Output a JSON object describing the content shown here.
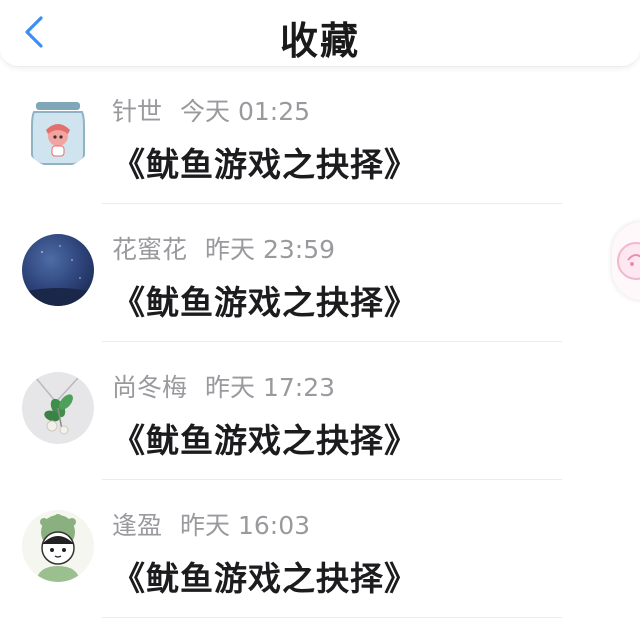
{
  "header": {
    "title": "收藏",
    "back_icon": "chevron-left-icon",
    "accent_color": "#3b8df5"
  },
  "favorites": [
    {
      "name": "针世",
      "time": "今天 01:25",
      "content": "《鱿鱼游戏之抉择》",
      "avatar": "glass-jar-avatar"
    },
    {
      "name": "花蜜花",
      "time": "昨天 23:59",
      "content": "《鱿鱼游戏之抉择》",
      "avatar": "night-sky-avatar"
    },
    {
      "name": "尚冬梅",
      "time": "昨天 17:23",
      "content": "《鱿鱼游戏之抉择》",
      "avatar": "brooch-avatar"
    },
    {
      "name": "逢盈",
      "time": "昨天 16:03",
      "content": "《鱿鱼游戏之抉择》",
      "avatar": "cartoon-girl-avatar"
    }
  ],
  "colors": {
    "meta_text": "#9a9a9e",
    "content_text": "#1c1c1e",
    "divider": "#ececef"
  }
}
